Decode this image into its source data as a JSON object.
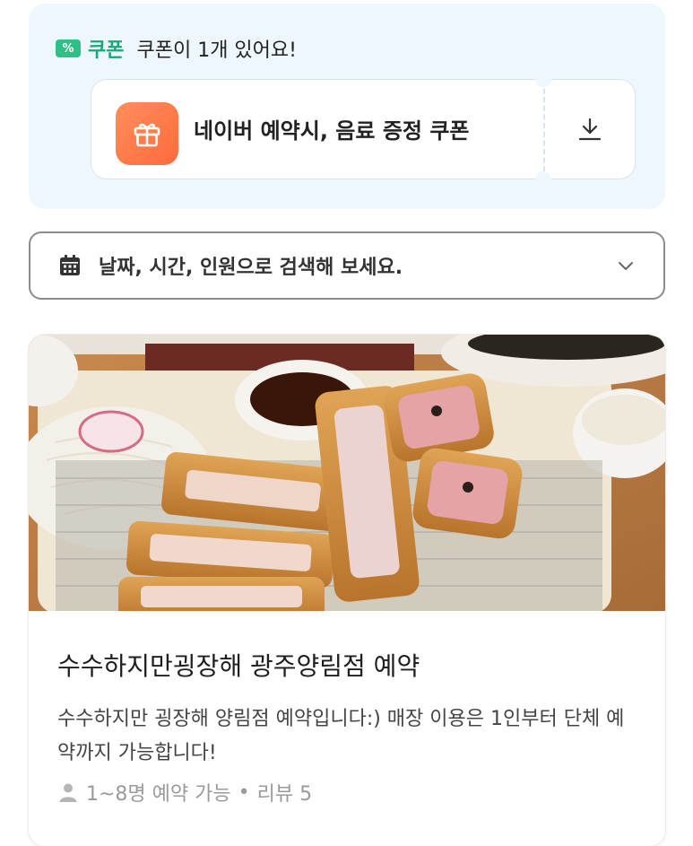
{
  "coupon": {
    "tag_icon": "%",
    "tag_label": "쿠폰",
    "count_text": "쿠폰이 1개 있어요!",
    "item": {
      "title": "네이버 예약시, 음료 증정 쿠폰",
      "icon": "gift-icon",
      "action_icon": "download-icon"
    },
    "accent_color": "#2fbf87"
  },
  "search": {
    "icon": "calendar-icon",
    "placeholder": "날짜, 시간, 인원으로 검색해 보세요.",
    "trailing_icon": "chevron-down-icon"
  },
  "store": {
    "image": "tonkatsu-photo",
    "name": "수수하지만굉장해 광주양림점 예약",
    "description": "수수하지만 굉장해 양림점 예약입니다:) 매장 이용은 1인부터 단체 예약까지 가능합니다!",
    "capacity": "1~8명 예약 가능",
    "separator": "•",
    "reviews": "리뷰 5",
    "person_icon": "person-icon"
  }
}
